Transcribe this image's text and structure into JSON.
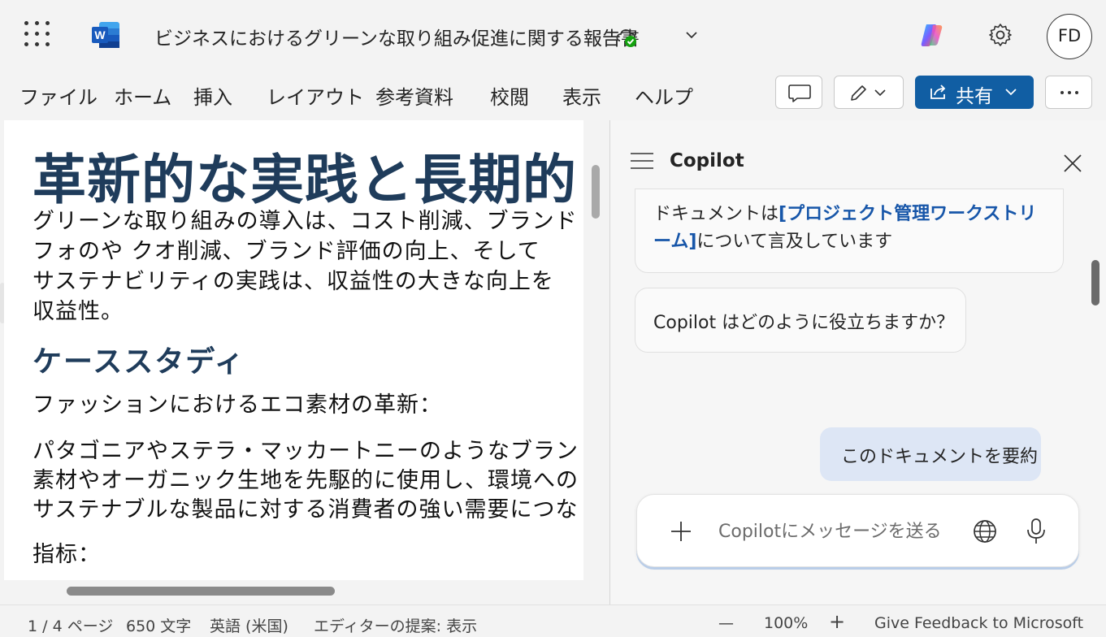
{
  "app": {
    "doc_title": "ビジネスにおけるグリーンな取り組み促進に関する報告書",
    "avatar_initials": "FD",
    "accent_color": "#115ea3"
  },
  "ribbon": {
    "menu": [
      "ファイル",
      "ホーム",
      "挿入",
      "レイアウト",
      "参考資料",
      "校閲",
      "表示",
      "ヘルプ"
    ],
    "share_label": "共有"
  },
  "document": {
    "heading1": "革新的な実践と長期的",
    "paragraph1": [
      "グリーンな取り組みの導入は、コスト削減、ブランド",
      "フォのや  クオ削減、ブランド評価の向上、そして",
      "サステナビリティの実践は、収益性の大きな向上を",
      "収益性。"
    ],
    "heading2": "ケーススタディ",
    "subheading": "ファッションにおけるエコ素材の革新：",
    "paragraph2": [
      "パタゴニアやステラ・マッカートニーのようなブラン",
      "素材やオーガニック生地を先駆的に使用し、環境への",
      "サステナブルな製品に対する消費者の強い需要につな"
    ],
    "metrics_label": "指标："
  },
  "copilot": {
    "title": "Copilot",
    "msg1_prefix": "ドキュメントは",
    "msg1_link": "[プロジェクト管理ワークストリーム]",
    "msg1_suffix": "について言及しています",
    "msg2": "Copilot はどのように役立ちますか？",
    "user_msg": "このドキュメントを要約",
    "input_placeholder": "Copilotにメッセージを送る"
  },
  "status": {
    "page": "1 / 4 ページ",
    "words": "650 文字",
    "language": "英語 (米国)",
    "editor": "エディターの提案: 表示",
    "zoom_minus": "—",
    "zoom": "100%",
    "zoom_plus": "+",
    "feedback": "Give Feedback to Microsoft"
  }
}
